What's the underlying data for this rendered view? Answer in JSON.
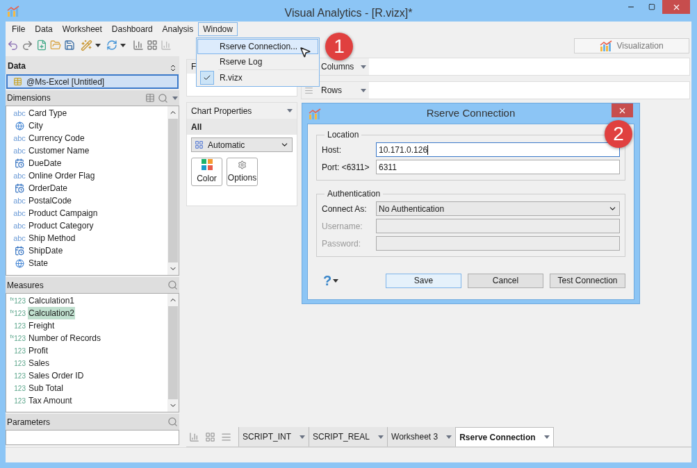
{
  "window": {
    "title": "Visual Analytics - [R.vizx]*"
  },
  "menu_bar": [
    {
      "label": "File",
      "selected": false
    },
    {
      "label": "Data",
      "selected": false
    },
    {
      "label": "Worksheet",
      "selected": false
    },
    {
      "label": "Dashboard",
      "selected": false
    },
    {
      "label": "Analysis",
      "selected": false
    },
    {
      "label": "Window",
      "selected": true
    }
  ],
  "window_menu": {
    "items": [
      {
        "label": "Rserve Connection...",
        "selected": true,
        "checked": false
      },
      {
        "label": "Rserve Log",
        "selected": false,
        "checked": false
      },
      {
        "label": "R.vizx",
        "selected": false,
        "checked": true
      }
    ]
  },
  "callouts": [
    "1",
    "2"
  ],
  "right_tab": {
    "label": "Visualization"
  },
  "data_panel": {
    "title": "Data",
    "source": "@Ms-Excel [Untitled]"
  },
  "dimensions": {
    "title": "Dimensions",
    "items": [
      {
        "kind": "text",
        "icon_text": "abc",
        "label": "Card Type"
      },
      {
        "kind": "geo",
        "label": "City"
      },
      {
        "kind": "text",
        "icon_text": "abc",
        "label": "Currency Code"
      },
      {
        "kind": "text",
        "icon_text": "abc",
        "label": "Customer Name"
      },
      {
        "kind": "date",
        "label": "DueDate"
      },
      {
        "kind": "text",
        "icon_text": "abc",
        "label": "Online Order Flag"
      },
      {
        "kind": "date",
        "label": "OrderDate"
      },
      {
        "kind": "text",
        "icon_text": "abc",
        "label": "PostalCode"
      },
      {
        "kind": "text",
        "icon_text": "abc",
        "label": "Product Campaign"
      },
      {
        "kind": "text",
        "icon_text": "abc",
        "label": "Product Category"
      },
      {
        "kind": "text",
        "icon_text": "abc",
        "label": "Ship Method"
      },
      {
        "kind": "date",
        "label": "ShipDate"
      },
      {
        "kind": "geo",
        "label": "State"
      }
    ]
  },
  "measures": {
    "title": "Measures",
    "items": [
      {
        "icon_text": "$^{fx}$123",
        "label": "Calculation1",
        "selected": false
      },
      {
        "icon_text": "$^{fx}$123",
        "label": "Calculation2",
        "selected": true
      },
      {
        "icon_text": "123",
        "label": "Freight",
        "selected": false
      },
      {
        "icon_text": "$^{fx}$123",
        "label": "Number of Records",
        "selected": false
      },
      {
        "icon_text": "123",
        "label": "Profit",
        "selected": false
      },
      {
        "icon_text": "123",
        "label": "Sales",
        "selected": false
      },
      {
        "icon_text": "123",
        "label": "Sales Order ID",
        "selected": false
      },
      {
        "icon_text": "123",
        "label": "Sub Total",
        "selected": false
      },
      {
        "icon_text": "123",
        "label": "Tax Amount",
        "selected": false
      }
    ]
  },
  "parameters": {
    "title": "Parameters"
  },
  "filters_panel": {
    "title": "F"
  },
  "chart_properties": {
    "title": "Chart Properties",
    "section": "All",
    "chart_type": "Automatic",
    "buttons": [
      {
        "kind": "color",
        "label": "Color"
      },
      {
        "kind": "options",
        "label": "Options"
      }
    ]
  },
  "shelves": [
    {
      "kind": "columns",
      "label": "Columns"
    },
    {
      "kind": "rows",
      "label": "Rows"
    }
  ],
  "dialog": {
    "title": "Rserve Connection",
    "sections": [
      {
        "title": "Location",
        "fields": [
          {
            "kind": "text",
            "label": "Host:",
            "value": "10.171.0.126",
            "disabled": false,
            "focused": true
          },
          {
            "kind": "text",
            "label": "Port: <6311>",
            "value": "6311",
            "disabled": false,
            "focused": false
          }
        ]
      },
      {
        "title": "Authentication",
        "fields": [
          {
            "kind": "select",
            "label": "Connect As:",
            "value": "No Authentication",
            "disabled": false,
            "focused": false
          },
          {
            "kind": "text",
            "label": "Username:",
            "disabled": true,
            "focused": false
          },
          {
            "kind": "text",
            "label": "Password:",
            "disabled": true,
            "focused": false
          }
        ]
      }
    ],
    "help": "?",
    "buttons": [
      {
        "label": "Save",
        "default": true
      },
      {
        "label": "Cancel",
        "default": false
      },
      {
        "label": "Test Connection",
        "default": false
      }
    ]
  },
  "sheet_tabs": [
    {
      "label": "SCRIPT_INT",
      "selected": false
    },
    {
      "label": "SCRIPT_REAL",
      "selected": false
    },
    {
      "label": "Worksheet 3",
      "selected": false
    },
    {
      "label": "Rserve Connection",
      "selected": true
    }
  ]
}
